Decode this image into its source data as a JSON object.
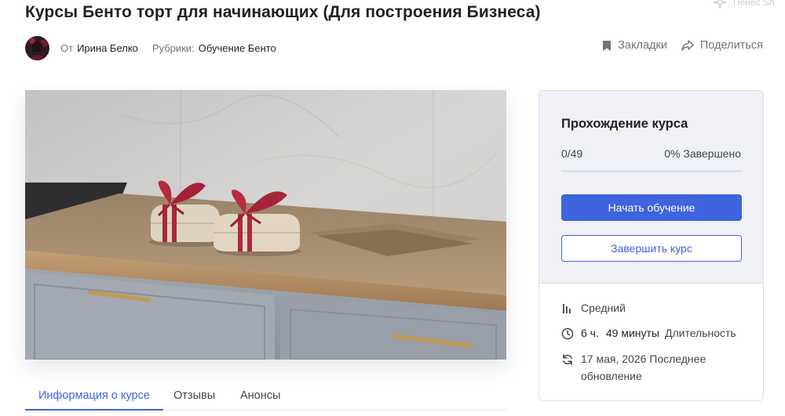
{
  "course": {
    "title": "Курсы Бенто торт для начинающих (Для построения Бизнеса)"
  },
  "corner_hint": {
    "text": "Пенес Sh",
    "icon": "sparkle-icon"
  },
  "meta": {
    "author_prefix": "От",
    "author_name": "Ирина Белко",
    "category_prefix": "Рубрики:",
    "category_name": "Обучение Бенто"
  },
  "actions": {
    "bookmark_label": "Закладки",
    "share_label": "Поделиться",
    "bookmark_icon": "bookmark-icon",
    "share_icon": "share-icon"
  },
  "tabs": [
    {
      "label": "Информация о курсе",
      "active": true
    },
    {
      "label": "Отзывы",
      "active": false
    },
    {
      "label": "Анонсы",
      "active": false
    }
  ],
  "card": {
    "title": "Прохождение курса",
    "progress_count": "0/49",
    "progress_percent_text": "0% Завершено",
    "progress_fraction": 0,
    "start_button": "Начать обучение",
    "complete_button": "Завершить курс",
    "level": "Средний",
    "duration_hours": "6 ч.",
    "duration_minutes": "49 минуты",
    "duration_label": "Длительность",
    "updated_text": "17 мая, 2026 Последнее обновление"
  },
  "colors": {
    "accent": "#3e64de",
    "card_bg": "#eff1f6",
    "text_dark": "#1f2125",
    "text_muted": "#6f737a"
  }
}
